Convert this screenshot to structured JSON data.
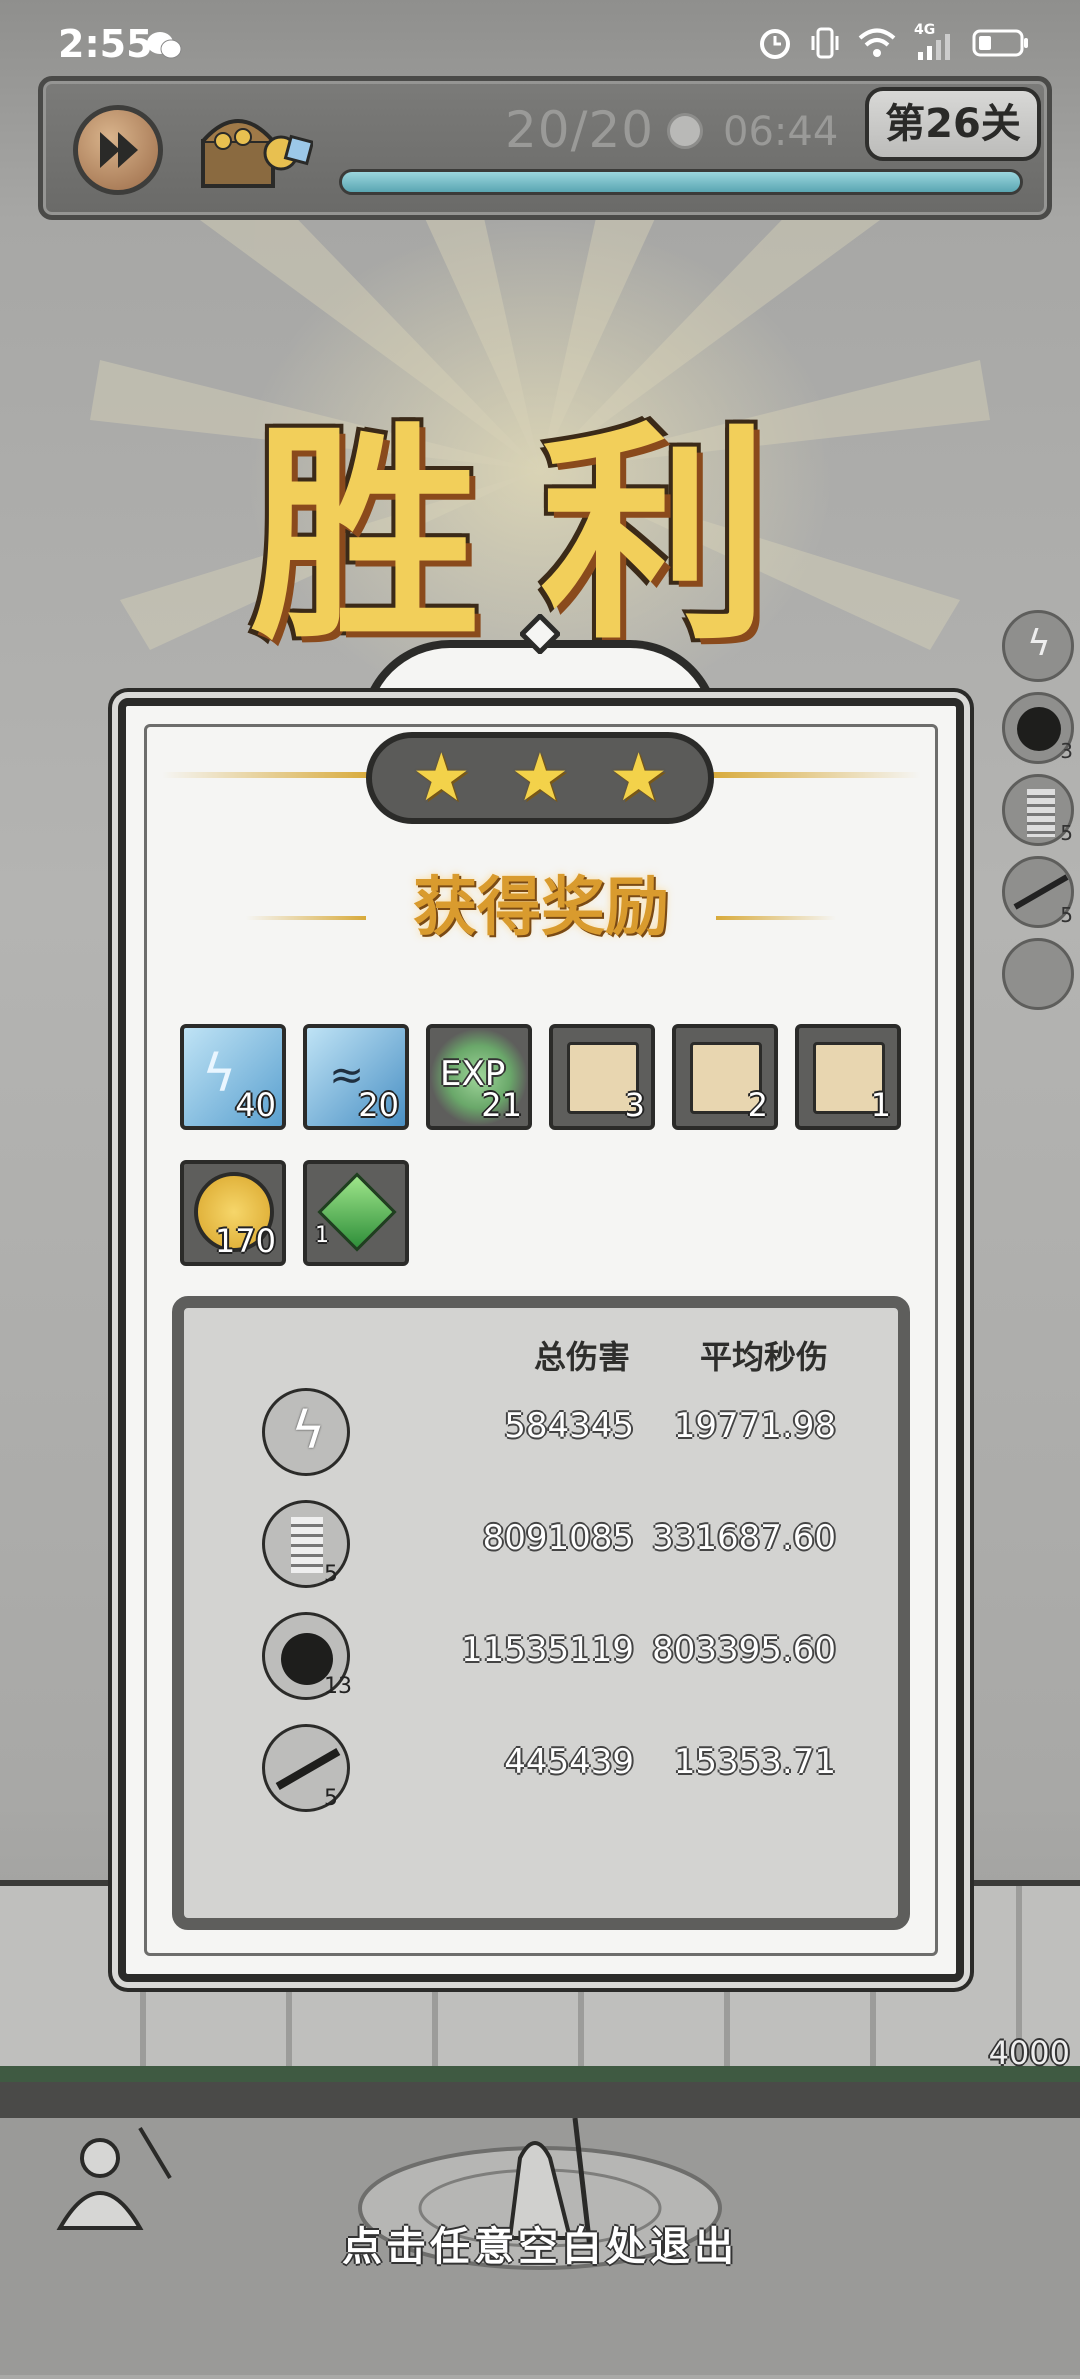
{
  "status_bar": {
    "time": "2:55",
    "icons": [
      "wechat-icon",
      "alarm-icon",
      "vibrate-icon",
      "wifi-icon",
      "4g-signal-icon",
      "battery-icon"
    ],
    "network_label": "4G"
  },
  "hud": {
    "wave": "20/20",
    "timer": "06:44",
    "level": "第26关",
    "progress": 1.0
  },
  "victory": {
    "title": "胜利",
    "stars": 3
  },
  "rewards": {
    "title": "获得奖励",
    "items": [
      {
        "icon": "lightning-gem-icon",
        "count": "40"
      },
      {
        "icon": "water-gem-icon",
        "count": "20"
      },
      {
        "icon": "exp-icon",
        "label": "EXP",
        "count": "21"
      },
      {
        "icon": "hat-scroll-icon",
        "count": "3"
      },
      {
        "icon": "boots-scroll-icon",
        "count": "2"
      },
      {
        "icon": "armor-scroll-icon",
        "count": "1"
      },
      {
        "icon": "gold-coin-icon",
        "count": "170"
      },
      {
        "icon": "green-crystal-icon",
        "count": "1"
      }
    ]
  },
  "stats": {
    "header_total": "总伤害",
    "header_dps": "平均秒伤",
    "rows": [
      {
        "icon": "lightning-skill-icon",
        "level": "",
        "total": "584345",
        "dps": "19771.98"
      },
      {
        "icon": "tornado-skill-icon",
        "level": "5",
        "total": "8091085",
        "dps": "331687.60"
      },
      {
        "icon": "bomb-skill-icon",
        "level": "13",
        "total": "11535119",
        "dps": "803395.60"
      },
      {
        "icon": "slash-skill-icon",
        "level": "5",
        "total": "445439",
        "dps": "15353.71"
      }
    ]
  },
  "side_skills": [
    "lightning-skill-icon",
    "bomb-skill-icon",
    "tornado-skill-icon",
    "slash-skill-icon",
    "empty-slot-icon"
  ],
  "side_skill_levels": [
    "",
    "3",
    "5",
    "5",
    ""
  ],
  "distance": "4000",
  "exit_hint": "点击任意空白处退出"
}
